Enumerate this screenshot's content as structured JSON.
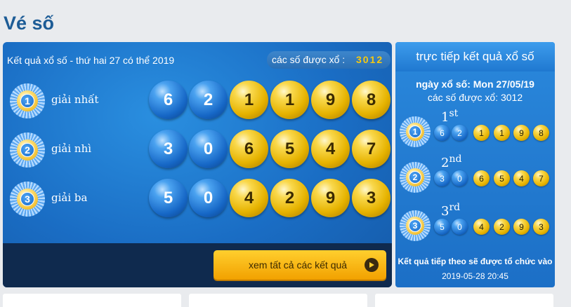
{
  "page_title": "Vé số",
  "main": {
    "header_title": "Kết quả xổ số - thứ hai 27 có thể 2019",
    "drawn_label": "các số được xổ :",
    "drawn_value": "3012",
    "prizes": [
      {
        "rank": "1",
        "label": "giải nhất",
        "balls": [
          {
            "n": "6",
            "c": "blue"
          },
          {
            "n": "2",
            "c": "blue"
          },
          {
            "n": "1",
            "c": "gold"
          },
          {
            "n": "1",
            "c": "gold"
          },
          {
            "n": "9",
            "c": "gold"
          },
          {
            "n": "8",
            "c": "gold"
          }
        ]
      },
      {
        "rank": "2",
        "label": "giải nhì",
        "balls": [
          {
            "n": "3",
            "c": "blue"
          },
          {
            "n": "0",
            "c": "blue"
          },
          {
            "n": "6",
            "c": "gold"
          },
          {
            "n": "5",
            "c": "gold"
          },
          {
            "n": "4",
            "c": "gold"
          },
          {
            "n": "7",
            "c": "gold"
          }
        ]
      },
      {
        "rank": "3",
        "label": "giải ba",
        "balls": [
          {
            "n": "5",
            "c": "blue"
          },
          {
            "n": "0",
            "c": "blue"
          },
          {
            "n": "4",
            "c": "gold"
          },
          {
            "n": "2",
            "c": "gold"
          },
          {
            "n": "9",
            "c": "gold"
          },
          {
            "n": "3",
            "c": "gold"
          }
        ]
      }
    ],
    "view_all_label": "xem tất cả các kết quả",
    "view_all_icon": "play-circle-icon"
  },
  "side": {
    "title": "trực tiếp kết quả xổ số",
    "date": "ngày xổ số: Mon 27/05/19",
    "drawn": "các số được xổ: 3012",
    "rows": [
      {
        "rank": "1",
        "ordinal_num": "1",
        "ordinal_suffix": "st",
        "balls": [
          {
            "n": "6",
            "c": "blue"
          },
          {
            "n": "2",
            "c": "blue"
          },
          {
            "n": "1",
            "c": "gold"
          },
          {
            "n": "1",
            "c": "gold"
          },
          {
            "n": "9",
            "c": "gold"
          },
          {
            "n": "8",
            "c": "gold"
          }
        ]
      },
      {
        "rank": "2",
        "ordinal_num": "2",
        "ordinal_suffix": "nd",
        "balls": [
          {
            "n": "3",
            "c": "blue"
          },
          {
            "n": "0",
            "c": "blue"
          },
          {
            "n": "6",
            "c": "gold"
          },
          {
            "n": "5",
            "c": "gold"
          },
          {
            "n": "4",
            "c": "gold"
          },
          {
            "n": "7",
            "c": "gold"
          }
        ]
      },
      {
        "rank": "3",
        "ordinal_num": "3",
        "ordinal_suffix": "rd",
        "balls": [
          {
            "n": "5",
            "c": "blue"
          },
          {
            "n": "0",
            "c": "blue"
          },
          {
            "n": "4",
            "c": "gold"
          },
          {
            "n": "2",
            "c": "gold"
          },
          {
            "n": "9",
            "c": "gold"
          },
          {
            "n": "3",
            "c": "gold"
          }
        ]
      }
    ],
    "next_draw_label": "Kết quả tiếp theo sẽ được tổ chức vào",
    "next_draw_time": "2019-05-28 20:45"
  },
  "colors": {
    "title": "#1d5c96",
    "accent_gold": "#f6c90e",
    "panel_blue": "#1a6dc4"
  }
}
